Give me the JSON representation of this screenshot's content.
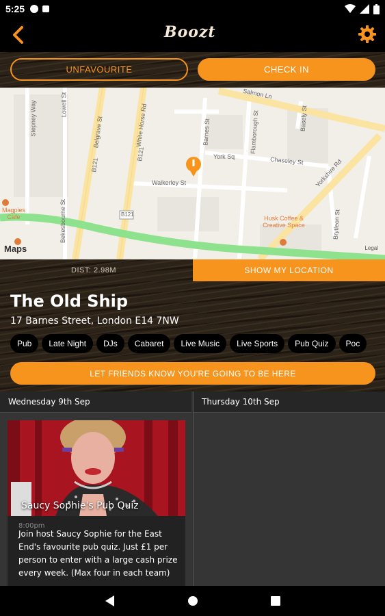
{
  "status_bar": {
    "time": "5:25"
  },
  "app_bar": {
    "logo_text": "Boozt"
  },
  "actions": {
    "unfavourite_label": "UNFAVOURITE",
    "check_in_label": "CHECK IN"
  },
  "map": {
    "streets": [
      "Stepney Way",
      "Belgrave St",
      "White Horse Rd",
      "Walkerley St",
      "Barnes St",
      "York Sq",
      "Flamborough St",
      "Chaseley St",
      "Salmon Ln",
      "Yorkshire Rd",
      "Bekesbourne St",
      "Lowell St",
      "Basely St",
      "Brytleon St"
    ],
    "route_labels": [
      "B121",
      "B121",
      "B121"
    ],
    "poi_1": "Magpies Cafe",
    "poi_2": "Husk Coffee & Creative Space",
    "attribution": "Maps",
    "legal": "Legal"
  },
  "venue": {
    "distance": "DIST: 2.98M",
    "show_location_label": "SHOW MY LOCATION",
    "name": "The Old Ship",
    "address": "17 Barnes Street, London E14 7NW",
    "tags": [
      "Pub",
      "Late Night",
      "DJs",
      "Cabaret",
      "Live Music",
      "Live Sports",
      "Pub Quiz",
      "Poc"
    ],
    "friends_label": "LET FRIENDS KNOW YOU'RE GOING TO BE HERE"
  },
  "schedule": {
    "days": [
      {
        "label": "Wednesday 9th Sep"
      },
      {
        "label": "Thursday 10th Sep"
      }
    ],
    "event": {
      "title": "Saucy Sophie's Pub Quiz",
      "time": "8:00pm",
      "description": "Join host Saucy Sophie for the East End's favourite pub quiz. Just £1 per person to enter with a large cash prize every week. (Max four in each team)"
    }
  },
  "colors": {
    "accent": "#f7941d",
    "wood": "#2b2218",
    "schedule_bg": "#353535"
  }
}
